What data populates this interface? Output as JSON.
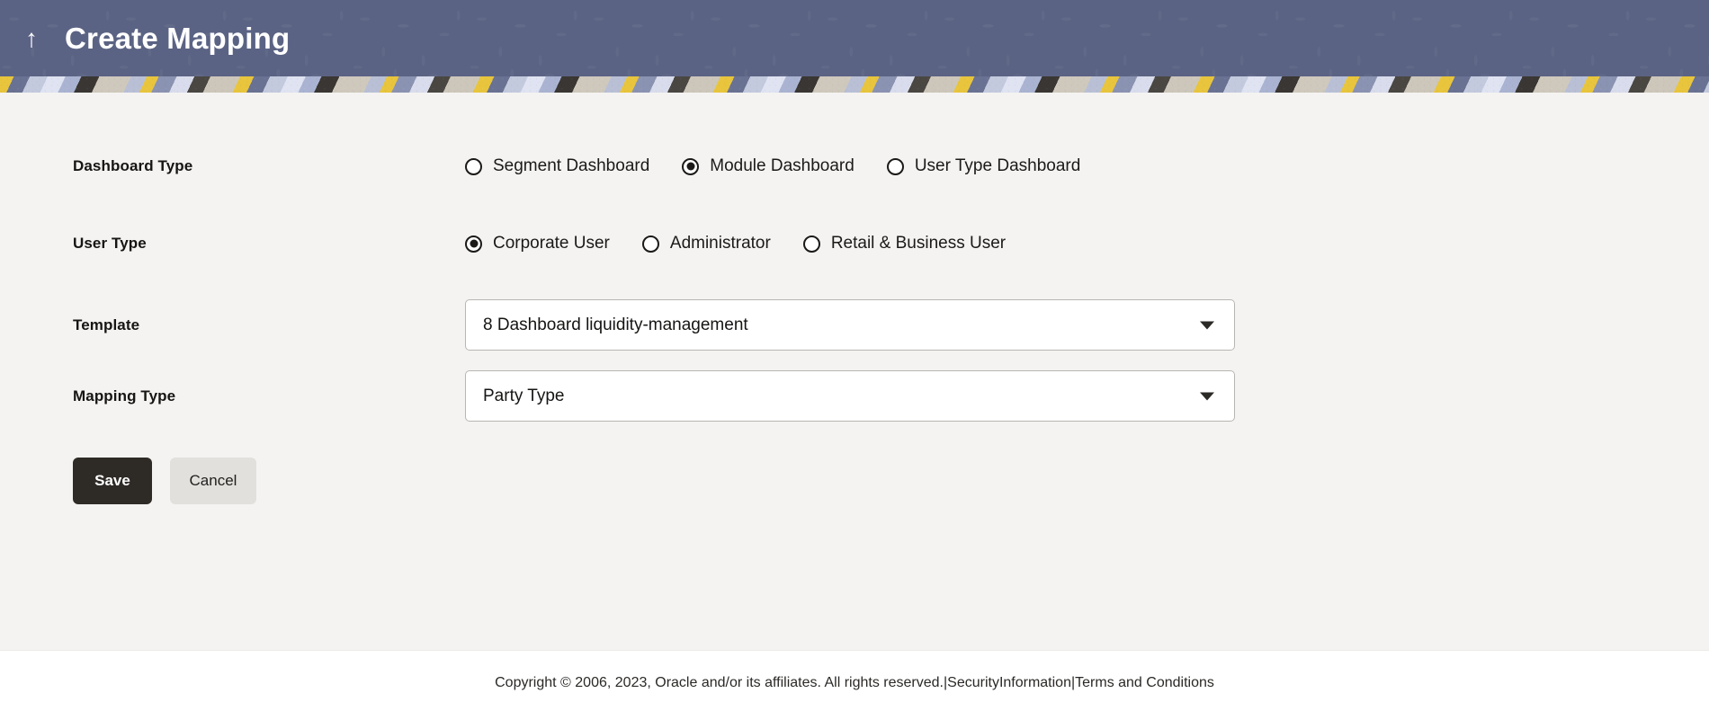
{
  "header": {
    "back_icon": "up-arrow-icon",
    "title": "Create Mapping"
  },
  "form": {
    "dashboard_type": {
      "label": "Dashboard Type",
      "options": [
        {
          "label": "Segment Dashboard",
          "selected": false
        },
        {
          "label": "Module Dashboard",
          "selected": true
        },
        {
          "label": "User Type Dashboard",
          "selected": false
        }
      ]
    },
    "user_type": {
      "label": "User Type",
      "options": [
        {
          "label": "Corporate User",
          "selected": true
        },
        {
          "label": "Administrator",
          "selected": false
        },
        {
          "label": "Retail & Business User",
          "selected": false
        }
      ]
    },
    "template": {
      "label": "Template",
      "value": "8 Dashboard liquidity-management",
      "arrow_icon": "chevron-down-icon"
    },
    "mapping_type": {
      "label": "Mapping Type",
      "value": "Party Type",
      "arrow_icon": "chevron-down-icon"
    }
  },
  "actions": {
    "save_label": "Save",
    "cancel_label": "Cancel"
  },
  "footer": {
    "text": "Copyright © 2006, 2023, Oracle and/or its affiliates. All rights reserved.|SecurityInformation|Terms and Conditions"
  },
  "colors": {
    "header_bg": "#5b6384",
    "content_bg": "#f4f3f1",
    "save_bg": "#2e2a26",
    "cancel_bg": "#e2e0dd",
    "accent_yellow": "#e8c53c"
  }
}
